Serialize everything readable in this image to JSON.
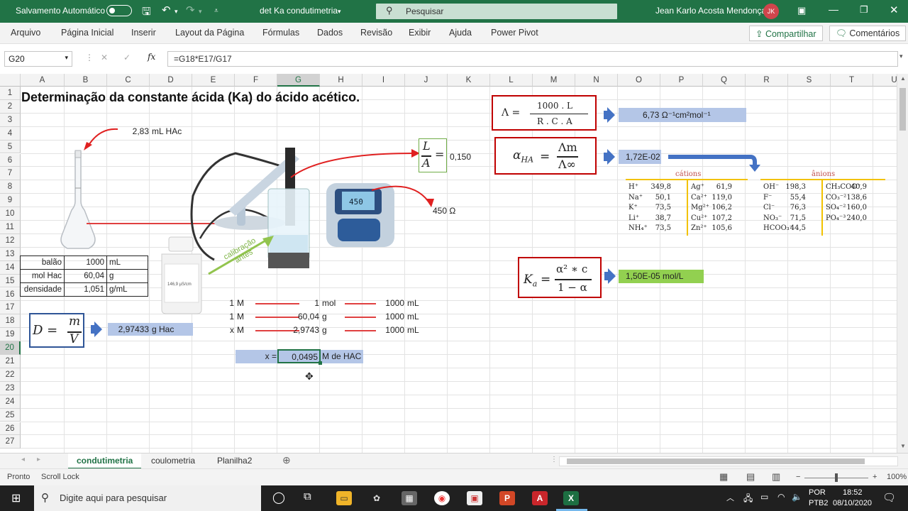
{
  "titlebar": {
    "autosave": "Salvamento Automático",
    "filename": "det Ka condutimetria",
    "search_placeholder": "Pesquisar",
    "user": "Jean Karlo Acosta Mendonça",
    "initials": "JK"
  },
  "menu": [
    "Arquivo",
    "Página Inicial",
    "Inserir",
    "Layout da Página",
    "Fórmulas",
    "Dados",
    "Revisão",
    "Exibir",
    "Ajuda",
    "Power Pivot"
  ],
  "share_label": "Compartilhar",
  "comments_label": "Comentários",
  "formula": {
    "namebox": "G20",
    "content": "=G18*E17/G17"
  },
  "columns": [
    "A",
    "B",
    "C",
    "D",
    "E",
    "F",
    "G",
    "H",
    "I",
    "J",
    "K",
    "L",
    "M",
    "N",
    "O",
    "P",
    "Q",
    "R",
    "S",
    "T",
    "U"
  ],
  "rows": [
    "1",
    "2",
    "3",
    "4",
    "5",
    "6",
    "7",
    "8",
    "9",
    "10",
    "11",
    "12",
    "13",
    "14",
    "15",
    "16",
    "17",
    "18",
    "19",
    "20",
    "21",
    "22",
    "23",
    "24",
    "25",
    "26",
    "27"
  ],
  "sheet": {
    "title": "Determinação da constante ácida (Ka) do ácido acético.",
    "vol_hac": "2,83",
    "vol_hac_unit": "mL HAc",
    "table": [
      {
        "label": "balão",
        "value": "1000",
        "unit": "mL"
      },
      {
        "label": "mol Hac",
        "value": "60,04",
        "unit": "g"
      },
      {
        "label": "densidade",
        "value": "1,051",
        "unit": "g/mL"
      }
    ],
    "density_result": "2,97433",
    "density_unit": "g Hac",
    "rule_rows": [
      {
        "a": "1",
        "ua": "M",
        "b": "1",
        "ub": "mol",
        "c": "1000",
        "uc": "mL"
      },
      {
        "a": "1",
        "ua": "M",
        "b": "60,04",
        "ub": "g",
        "c": "1000",
        "uc": "mL"
      },
      {
        "a": "x",
        "ua": "M",
        "b": "2,9743",
        "ub": "g",
        "c": "1000",
        "uc": "mL"
      }
    ],
    "x_label": "x =",
    "x_value": "0,0495",
    "x_unit": "M de HAC",
    "la_value": "0,150",
    "resistance": "450 Ω",
    "lambda_value": "6,73 Ω⁻¹cm²mol⁻¹",
    "alpha_value": "1,72E-02",
    "ka_value": "1,50E-05 mol/L",
    "calib": "calibração antes",
    "meter_display": "450",
    "bottle_label": "146,9 µS/cm"
  },
  "formulas": {
    "lambda_num": "1000 . L",
    "lambda_den": "R . C . A",
    "lambda_sym": "Λ  =",
    "alpha_sym": "α",
    "alpha_sub": "HA",
    "alpha_num": "Λm",
    "alpha_den": "Λ∞",
    "ka_sym": "K",
    "ka_sub": "a",
    "ka_num": "α² ∗ c",
    "ka_den": "1 − α",
    "d_sym": "D  =",
    "d_num": "m",
    "d_den": "V",
    "la_num": "L",
    "la_den": "A"
  },
  "cations": {
    "title": "cátions",
    "rows": [
      [
        "H⁺",
        "349,8",
        "Ag⁺",
        "61,9"
      ],
      [
        "Na⁺",
        "50,1",
        "Ca²⁺",
        "119,0"
      ],
      [
        "K⁺",
        "73,5",
        "Mg²⁺",
        "106,2"
      ],
      [
        "Li⁺",
        "38,7",
        "Cu²⁺",
        "107,2"
      ],
      [
        "NH₄⁺",
        "73,5",
        "Zn²⁺",
        "105,6"
      ]
    ]
  },
  "anions": {
    "title": "ânions",
    "rows": [
      [
        "OH⁻",
        "198,3",
        "CH₃COO⁻",
        "40,9"
      ],
      [
        "F⁻",
        "55,4",
        "CO₃⁻²",
        "138,6"
      ],
      [
        "Cl⁻",
        "76,3",
        "SO₄⁻²",
        "160,0"
      ],
      [
        "NO₃⁻",
        "71,5",
        "PO₄⁻³",
        "240,0"
      ],
      [
        "HCOO₃⁻",
        "44,5",
        "",
        ""
      ]
    ]
  },
  "tabs": [
    "condutimetria",
    "coulometria",
    "Planilha2"
  ],
  "status": {
    "ready": "Pronto",
    "scroll": "Scroll Lock",
    "zoom": "100%"
  },
  "taskbar": {
    "search": "Digite aqui para pesquisar",
    "lang": "POR",
    "layout": "PTB2",
    "time": "18:52",
    "date": "08/10/2020"
  },
  "colors": {
    "excel_green": "#217346",
    "fill_blue": "#b4c6e7",
    "fill_green": "#92d050",
    "red": "#c00000"
  }
}
